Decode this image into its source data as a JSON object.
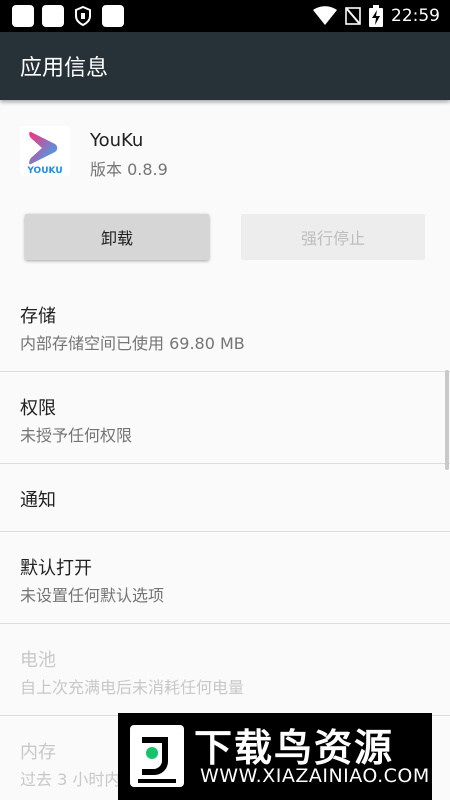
{
  "status_bar": {
    "time": "22:59",
    "icons": [
      "notification-square-icon",
      "notification-square-icon",
      "shield-icon",
      "notification-square-icon",
      "wifi-icon",
      "no-signal-icon",
      "battery-charging-icon"
    ]
  },
  "app_bar": {
    "title": "应用信息"
  },
  "app": {
    "name": "YouKu",
    "version": "版本 0.8.9",
    "icon_text": "YOUKU"
  },
  "buttons": {
    "uninstall": "卸载",
    "force_stop": "强行停止"
  },
  "items": [
    {
      "title": "存储",
      "subtitle": "内部存储空间已使用 69.80 MB"
    },
    {
      "title": "权限",
      "subtitle": "未授予任何权限"
    },
    {
      "title": "通知"
    },
    {
      "title": "默认打开",
      "subtitle": "未设置任何默认选项"
    },
    {
      "title": "电池",
      "subtitle": "自上次充满电后未消耗任何电量",
      "disabled": true
    },
    {
      "title": "内存",
      "subtitle": "过去 3 小时内",
      "disabled": true
    }
  ],
  "watermark": {
    "title": "下载鸟资源",
    "url": "WWW.XIAZAINIAO.COM"
  },
  "colors": {
    "app_bar": "#263238",
    "status_bar": "#000000",
    "youku_pink": "#ff2d7a",
    "youku_blue": "#1fb6ff",
    "watermark_green": "#16c26b"
  }
}
